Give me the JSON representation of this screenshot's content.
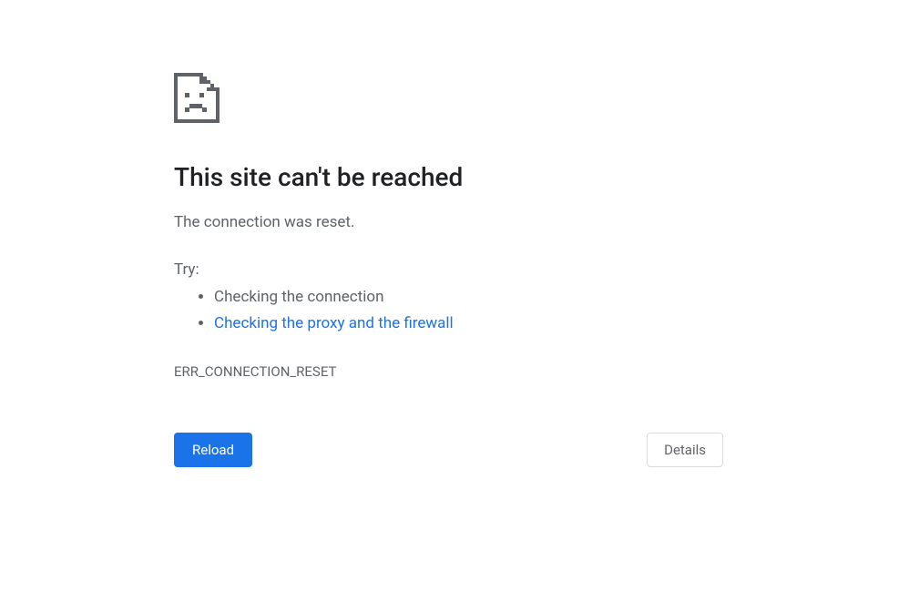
{
  "heading": "This site can't be reached",
  "subtext": "The connection was reset.",
  "try_label": "Try:",
  "suggestions": {
    "item0": "Checking the connection",
    "item1": "Checking the proxy and the firewall"
  },
  "error_code": "ERR_CONNECTION_RESET",
  "buttons": {
    "reload": "Reload",
    "details": "Details"
  }
}
